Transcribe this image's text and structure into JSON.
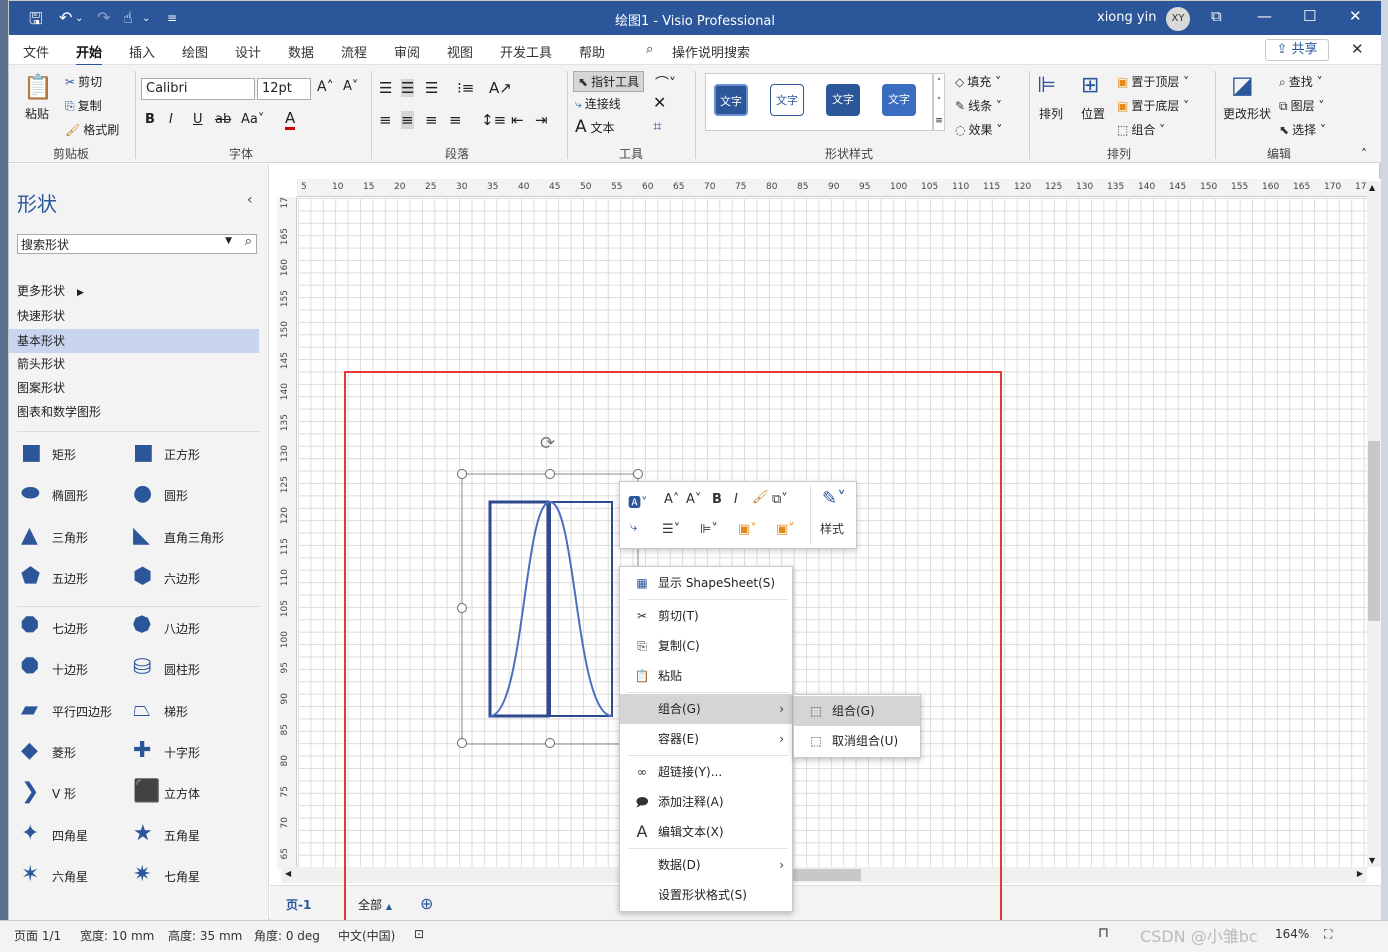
{
  "window": {
    "title": "绘图1  -  Visio Professional",
    "user_name": "xiong yin",
    "user_initials": "XY"
  },
  "menu": {
    "tabs": [
      "文件",
      "开始",
      "插入",
      "绘图",
      "设计",
      "数据",
      "流程",
      "审阅",
      "视图",
      "开发工具",
      "帮助"
    ],
    "active_tab": "开始",
    "search": "操作说明搜索",
    "share": "共享"
  },
  "ribbon": {
    "clipboard": {
      "paste": "粘贴",
      "cut": "剪切",
      "copy": "复制",
      "format_painter": "格式刷",
      "label": "剪贴板"
    },
    "font": {
      "name": "Calibri",
      "size": "12pt",
      "label": "字体"
    },
    "paragraph": {
      "label": "段落"
    },
    "tools": {
      "pointer": "指针工具",
      "connector": "连接线",
      "text": "文本",
      "label": "工具"
    },
    "shape_styles": {
      "sample": "文字",
      "fill": "填充",
      "line": "线条",
      "effect": "效果",
      "label": "形状样式"
    },
    "arrange": {
      "arrange": "排列",
      "position": "位置",
      "bring_front": "置于顶层",
      "send_back": "置于底层",
      "group": "组合",
      "label": "排列"
    },
    "editing": {
      "change_shape": "更改形状",
      "find": "查找",
      "layers": "图层",
      "select": "选择",
      "label": "编辑"
    }
  },
  "shapes_pane": {
    "title": "形状",
    "search_placeholder": "搜索形状",
    "categories": [
      "更多形状",
      "快速形状",
      "基本形状",
      "箭头形状",
      "图案形状",
      "图表和数学图形"
    ],
    "selected_category": "基本形状",
    "shapes": [
      "矩形",
      "正方形",
      "椭圆形",
      "圆形",
      "三角形",
      "直角三角形",
      "五边形",
      "六边形",
      "七边形",
      "八边形",
      "十边形",
      "圆柱形",
      "平行四边形",
      "梯形",
      "菱形",
      "十字形",
      "V 形",
      "立方体",
      "四角星",
      "五角星",
      "六角星",
      "七角星"
    ]
  },
  "rulers": {
    "h_ticks": [
      "5",
      "10",
      "15",
      "20",
      "25",
      "30",
      "35",
      "40",
      "45",
      "50",
      "55",
      "60",
      "65",
      "70",
      "75",
      "80",
      "85",
      "90",
      "95",
      "100",
      "105",
      "110",
      "115",
      "120",
      "125",
      "130",
      "135",
      "140",
      "145",
      "150",
      "155",
      "160",
      "165",
      "170",
      "17"
    ],
    "v_ticks": [
      "17",
      "165",
      "160",
      "155",
      "150",
      "145",
      "140",
      "135",
      "130",
      "125",
      "120",
      "115",
      "110",
      "105",
      "100",
      "95",
      "90",
      "85",
      "80",
      "75",
      "70",
      "65"
    ]
  },
  "mini_toolbar": {
    "style_label": "样式"
  },
  "context_menu": {
    "items": [
      "显示 ShapeSheet(S)",
      "剪切(T)",
      "复制(C)",
      "粘贴",
      "组合(G)",
      "容器(E)",
      "超链接(Y)...",
      "添加注释(A)",
      "编辑文本(X)",
      "数据(D)",
      "设置形状格式(S)"
    ],
    "highlighted": "组合(G)",
    "submenu": [
      "组合(G)",
      "取消组合(U)"
    ]
  },
  "pagebar": {
    "page_tab": "页-1",
    "all_label": "全部"
  },
  "status": {
    "page": "页面 1/1",
    "width": "宽度: 10 mm",
    "height": "高度: 35 mm",
    "angle": "角度: 0 deg",
    "language": "中文(中国)",
    "zoom": "164%",
    "watermark": "CSDN @小雏bc"
  },
  "colors": {
    "brand": "#2b579a",
    "shape_fill": "#2b579a",
    "annotation": "#e53935"
  }
}
